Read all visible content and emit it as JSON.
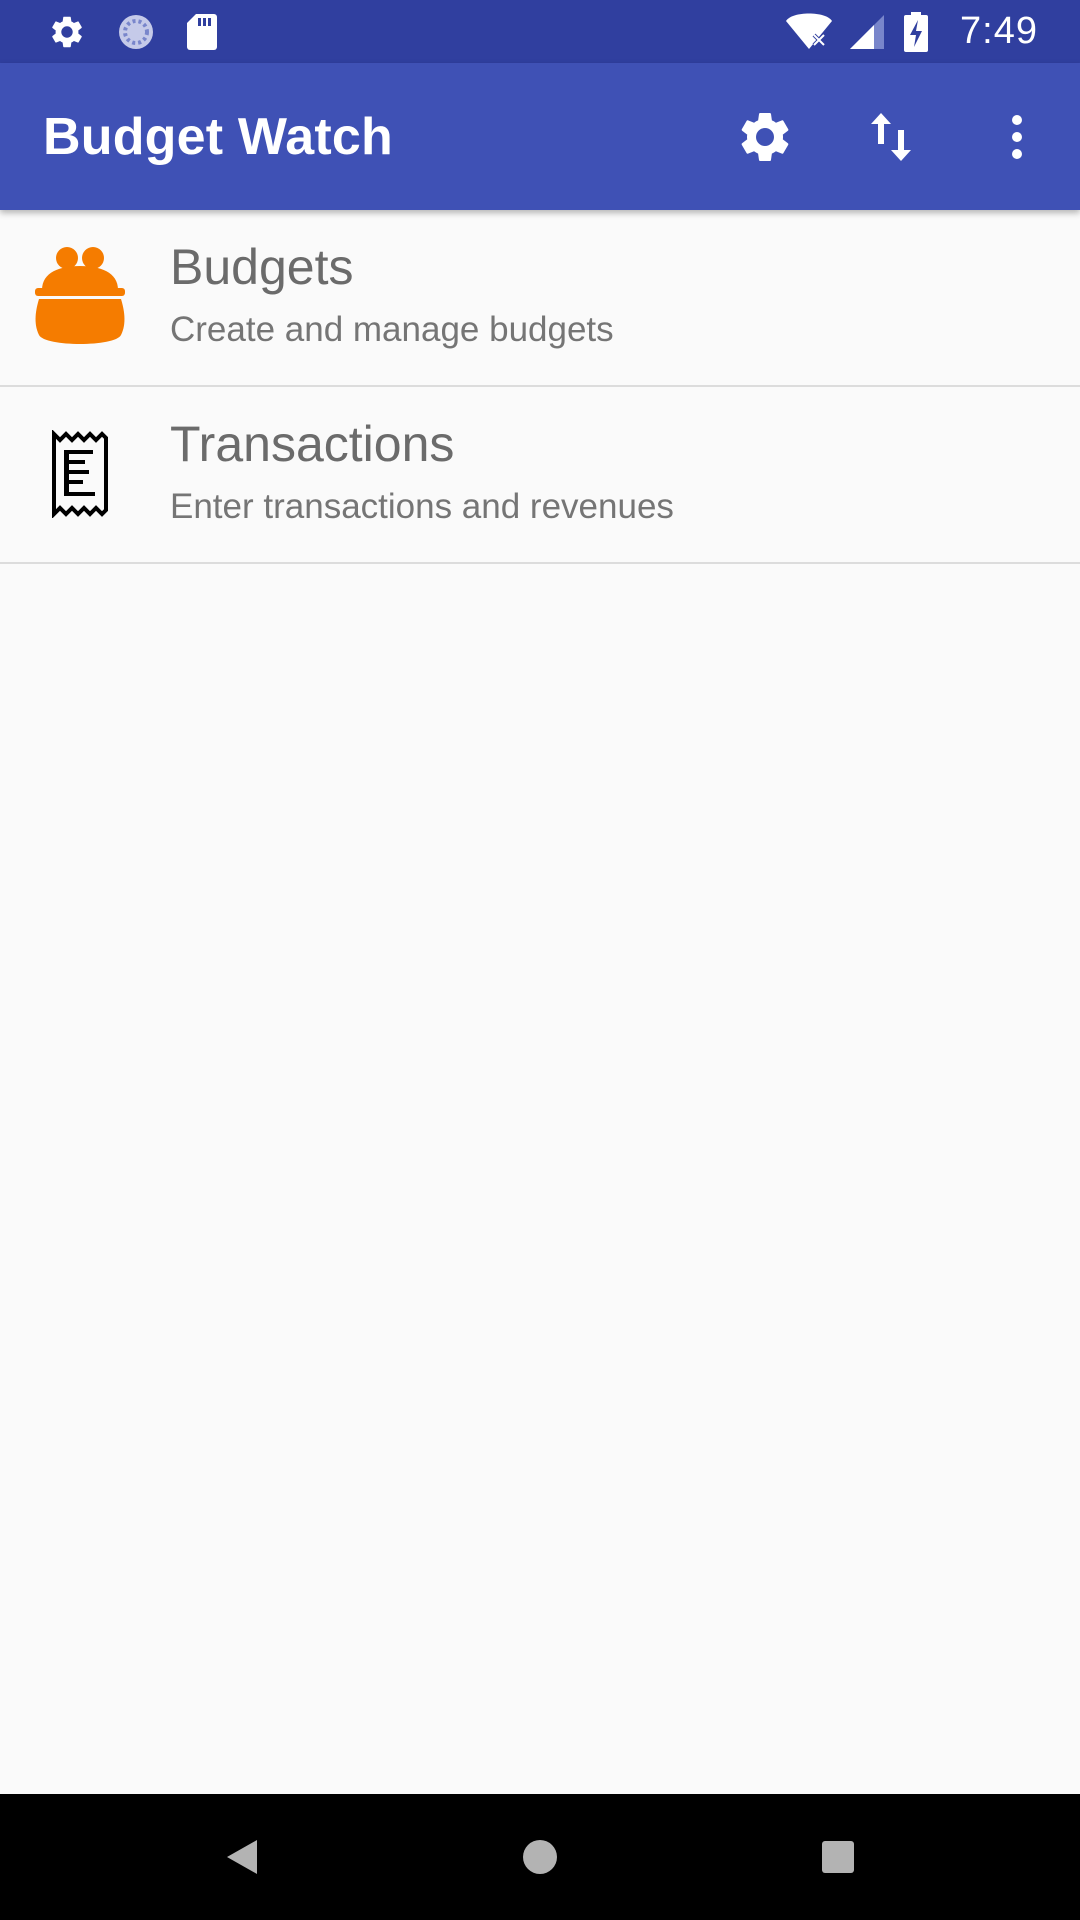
{
  "status_bar": {
    "time": "7:49",
    "left_icons": [
      "settings-icon",
      "sync-icon",
      "sd-card-icon"
    ],
    "right_icons": [
      "wifi-off-icon",
      "signal-icon",
      "battery-charging-icon"
    ]
  },
  "app_bar": {
    "title": "Budget Watch",
    "actions": [
      "settings-icon",
      "import-export-icon",
      "overflow-menu-icon"
    ]
  },
  "list": {
    "items": [
      {
        "title": "Budgets",
        "subtitle": "Create and manage budgets",
        "icon": "purse-icon",
        "icon_color": "#f57c00"
      },
      {
        "title": "Transactions",
        "subtitle": "Enter transactions and revenues",
        "icon": "receipt-icon",
        "icon_color": "#000000"
      }
    ]
  },
  "nav_bar": {
    "buttons": [
      "back-icon",
      "home-icon",
      "recents-icon"
    ]
  },
  "colors": {
    "status_bar": "#303f9f",
    "app_bar": "#3f51b5",
    "background": "#fafafa"
  }
}
